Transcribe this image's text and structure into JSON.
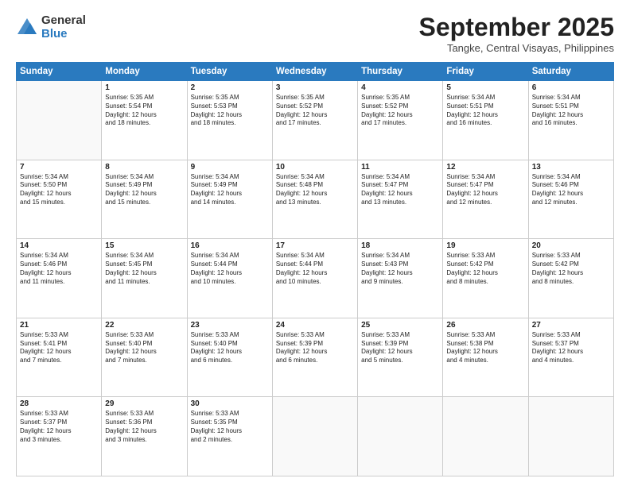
{
  "header": {
    "logo_general": "General",
    "logo_blue": "Blue",
    "month_title": "September 2025",
    "location": "Tangke, Central Visayas, Philippines"
  },
  "days": [
    "Sunday",
    "Monday",
    "Tuesday",
    "Wednesday",
    "Thursday",
    "Friday",
    "Saturday"
  ],
  "weeks": [
    [
      {
        "num": "",
        "info": ""
      },
      {
        "num": "1",
        "info": "Sunrise: 5:35 AM\nSunset: 5:54 PM\nDaylight: 12 hours\nand 18 minutes."
      },
      {
        "num": "2",
        "info": "Sunrise: 5:35 AM\nSunset: 5:53 PM\nDaylight: 12 hours\nand 18 minutes."
      },
      {
        "num": "3",
        "info": "Sunrise: 5:35 AM\nSunset: 5:52 PM\nDaylight: 12 hours\nand 17 minutes."
      },
      {
        "num": "4",
        "info": "Sunrise: 5:35 AM\nSunset: 5:52 PM\nDaylight: 12 hours\nand 17 minutes."
      },
      {
        "num": "5",
        "info": "Sunrise: 5:34 AM\nSunset: 5:51 PM\nDaylight: 12 hours\nand 16 minutes."
      },
      {
        "num": "6",
        "info": "Sunrise: 5:34 AM\nSunset: 5:51 PM\nDaylight: 12 hours\nand 16 minutes."
      }
    ],
    [
      {
        "num": "7",
        "info": "Sunrise: 5:34 AM\nSunset: 5:50 PM\nDaylight: 12 hours\nand 15 minutes."
      },
      {
        "num": "8",
        "info": "Sunrise: 5:34 AM\nSunset: 5:49 PM\nDaylight: 12 hours\nand 15 minutes."
      },
      {
        "num": "9",
        "info": "Sunrise: 5:34 AM\nSunset: 5:49 PM\nDaylight: 12 hours\nand 14 minutes."
      },
      {
        "num": "10",
        "info": "Sunrise: 5:34 AM\nSunset: 5:48 PM\nDaylight: 12 hours\nand 13 minutes."
      },
      {
        "num": "11",
        "info": "Sunrise: 5:34 AM\nSunset: 5:47 PM\nDaylight: 12 hours\nand 13 minutes."
      },
      {
        "num": "12",
        "info": "Sunrise: 5:34 AM\nSunset: 5:47 PM\nDaylight: 12 hours\nand 12 minutes."
      },
      {
        "num": "13",
        "info": "Sunrise: 5:34 AM\nSunset: 5:46 PM\nDaylight: 12 hours\nand 12 minutes."
      }
    ],
    [
      {
        "num": "14",
        "info": "Sunrise: 5:34 AM\nSunset: 5:46 PM\nDaylight: 12 hours\nand 11 minutes."
      },
      {
        "num": "15",
        "info": "Sunrise: 5:34 AM\nSunset: 5:45 PM\nDaylight: 12 hours\nand 11 minutes."
      },
      {
        "num": "16",
        "info": "Sunrise: 5:34 AM\nSunset: 5:44 PM\nDaylight: 12 hours\nand 10 minutes."
      },
      {
        "num": "17",
        "info": "Sunrise: 5:34 AM\nSunset: 5:44 PM\nDaylight: 12 hours\nand 10 minutes."
      },
      {
        "num": "18",
        "info": "Sunrise: 5:34 AM\nSunset: 5:43 PM\nDaylight: 12 hours\nand 9 minutes."
      },
      {
        "num": "19",
        "info": "Sunrise: 5:33 AM\nSunset: 5:42 PM\nDaylight: 12 hours\nand 8 minutes."
      },
      {
        "num": "20",
        "info": "Sunrise: 5:33 AM\nSunset: 5:42 PM\nDaylight: 12 hours\nand 8 minutes."
      }
    ],
    [
      {
        "num": "21",
        "info": "Sunrise: 5:33 AM\nSunset: 5:41 PM\nDaylight: 12 hours\nand 7 minutes."
      },
      {
        "num": "22",
        "info": "Sunrise: 5:33 AM\nSunset: 5:40 PM\nDaylight: 12 hours\nand 7 minutes."
      },
      {
        "num": "23",
        "info": "Sunrise: 5:33 AM\nSunset: 5:40 PM\nDaylight: 12 hours\nand 6 minutes."
      },
      {
        "num": "24",
        "info": "Sunrise: 5:33 AM\nSunset: 5:39 PM\nDaylight: 12 hours\nand 6 minutes."
      },
      {
        "num": "25",
        "info": "Sunrise: 5:33 AM\nSunset: 5:39 PM\nDaylight: 12 hours\nand 5 minutes."
      },
      {
        "num": "26",
        "info": "Sunrise: 5:33 AM\nSunset: 5:38 PM\nDaylight: 12 hours\nand 4 minutes."
      },
      {
        "num": "27",
        "info": "Sunrise: 5:33 AM\nSunset: 5:37 PM\nDaylight: 12 hours\nand 4 minutes."
      }
    ],
    [
      {
        "num": "28",
        "info": "Sunrise: 5:33 AM\nSunset: 5:37 PM\nDaylight: 12 hours\nand 3 minutes."
      },
      {
        "num": "29",
        "info": "Sunrise: 5:33 AM\nSunset: 5:36 PM\nDaylight: 12 hours\nand 3 minutes."
      },
      {
        "num": "30",
        "info": "Sunrise: 5:33 AM\nSunset: 5:35 PM\nDaylight: 12 hours\nand 2 minutes."
      },
      {
        "num": "",
        "info": ""
      },
      {
        "num": "",
        "info": ""
      },
      {
        "num": "",
        "info": ""
      },
      {
        "num": "",
        "info": ""
      }
    ]
  ]
}
